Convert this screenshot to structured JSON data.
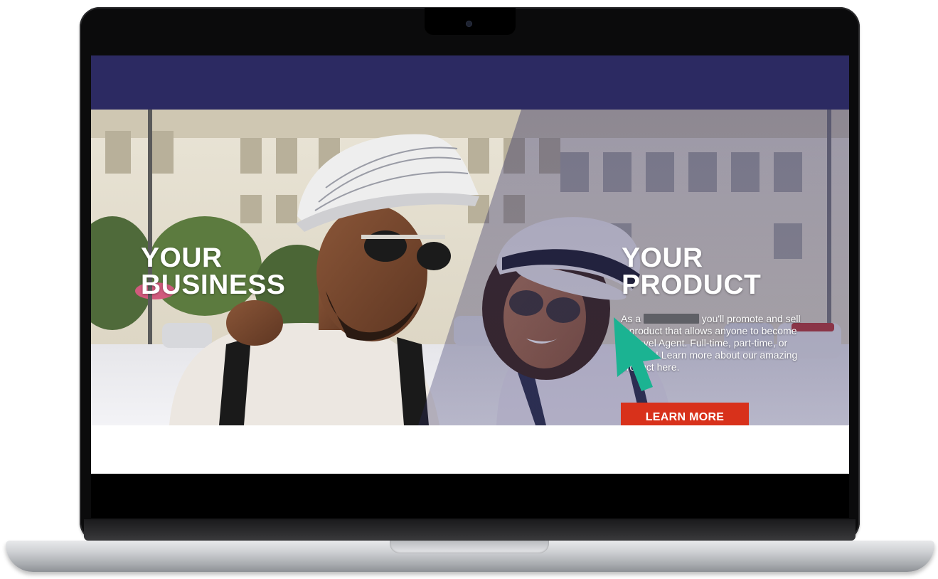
{
  "hero": {
    "left_headline_line1": "YOUR",
    "left_headline_line2": "BUSINESS",
    "right_headline_line1": "YOUR",
    "right_headline_line2": "PRODUCT",
    "body_before_redaction": "As a ",
    "body_after_redaction": " you'll promote and sell a product that allows anyone to become a Travel Agent. Full-time, part-time, or anytime! Learn more about our amazing product here.",
    "cta_label": "LEARN MORE"
  },
  "colors": {
    "nav_bar": "#2c2a62",
    "cta_button": "#d8311b",
    "cursor": "#1bb392"
  },
  "icons": {
    "pointer": "cursor-arrow-icon",
    "camera": "webcam-icon"
  }
}
